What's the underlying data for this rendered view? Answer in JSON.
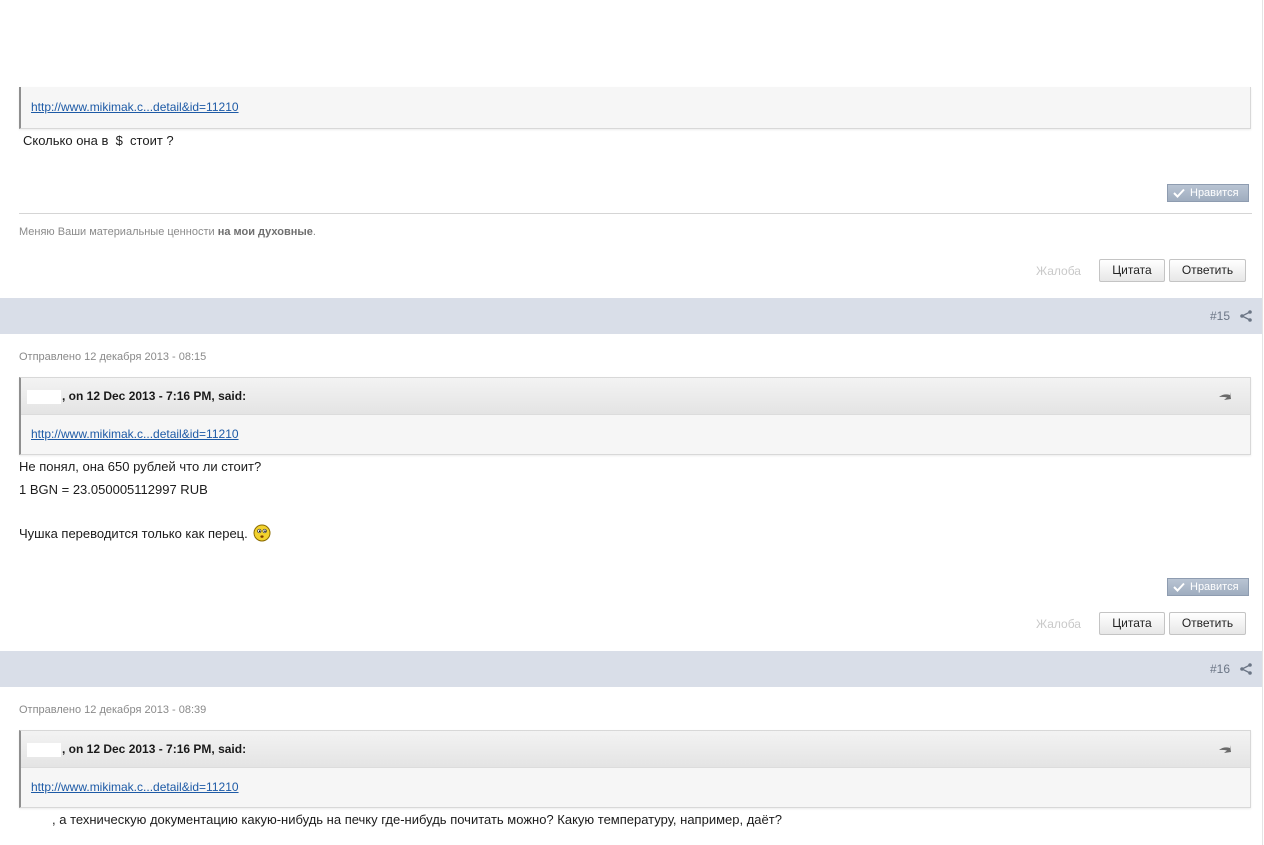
{
  "quote_link": "http://www.mikimak.c...detail&id=11210",
  "post14": {
    "text": "Сколько она в  $  стоит ?",
    "like_label": "Нравится",
    "signature_normal": "Меняю Ваши материальные ценности ",
    "signature_bold": "на мои духовные",
    "signature_end": ".",
    "report_label": "Жалоба",
    "quote_button": "Цитата",
    "reply_button": "Ответить"
  },
  "post15": {
    "number": "#15",
    "posted": "Отправлено 12 декабря 2013 - 08:15",
    "quote_header": ", on 12 Dec 2013 - 7:16 PM, said:",
    "lines": [
      "Не понял, она 650 рублей что ли стоит?",
      "1 BGN = 23.050005112997 RUB",
      "Чушка переводится только как перец."
    ],
    "like_label": "Нравится",
    "report_label": "Жалоба",
    "quote_button": "Цитата",
    "reply_button": "Ответить"
  },
  "post16": {
    "number": "#16",
    "posted": "Отправлено 12 декабря 2013 - 08:39",
    "quote_header": ", on 12 Dec 2013 - 7:16 PM, said:",
    "text": ", а техническую документацию какую-нибудь на печку где-нибудь почитать можно? Какую температуру, например, даёт?"
  }
}
